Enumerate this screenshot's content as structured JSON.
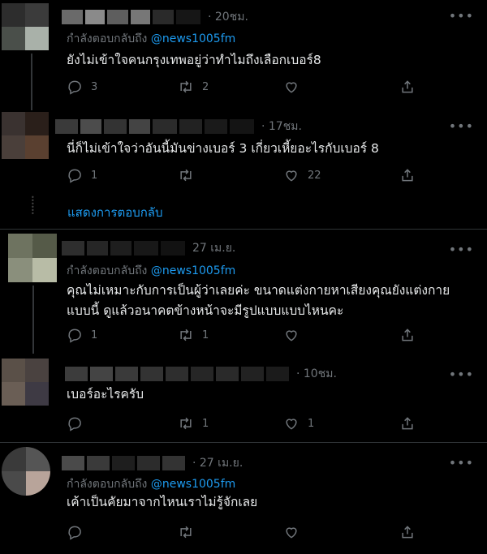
{
  "tweets": [
    {
      "time": "· 20ชม.",
      "replying_prefix": "กำลังตอบกลับถึง",
      "replying_handle": "@news1005fm",
      "text": "ยังไม่เข้าใจคนกรุงเทพอยู่ว่าทำไมถึงเลือกเบอร์8",
      "reply_count": "3",
      "retweet_count": "2",
      "like_count": ""
    },
    {
      "time": "· 17ชม.",
      "text": "นี่ก็ไม่เข้าใจว่าอันนี้มันข่างเบอร์ 3 เกี่ยวเหี้ยอะไรกับเบอร์ 8",
      "reply_count": "1",
      "retweet_count": "",
      "like_count": "22",
      "show_replies": "แสดงการตอบกลับ"
    },
    {
      "time": "27 เม.ย.",
      "replying_prefix": "กำลังตอบกลับถึง",
      "replying_handle": "@news1005fm",
      "text_line1": "คุณไม่เหมาะกับการเป็นผู้ว่าเลยค่ะ ขนาดแต่งกายหาเสียงคุณยังแต่งกาย",
      "text_line2": "แบบนี้ ดูแล้วอนาคตข้างหน้าจะมีรูปแบบแบบไหนคะ",
      "reply_count": "1",
      "retweet_count": "1",
      "like_count": ""
    },
    {
      "time": "· 10ชม.",
      "text": "เบอร์อะไรครับ",
      "reply_count": "",
      "retweet_count": "1",
      "like_count": "1"
    },
    {
      "time": "· 27 เม.ย.",
      "replying_prefix": "กำลังตอบกลับถึง",
      "replying_handle": "@news1005fm",
      "text": "เค้าเป็นคัยมาจากไหนเราไม่รู้จักเลย",
      "reply_count": "",
      "retweet_count": "",
      "like_count": ""
    }
  ],
  "more_label": "•••",
  "icons": [
    "reply-icon",
    "retweet-icon",
    "like-icon",
    "share-icon",
    "more-icon"
  ]
}
